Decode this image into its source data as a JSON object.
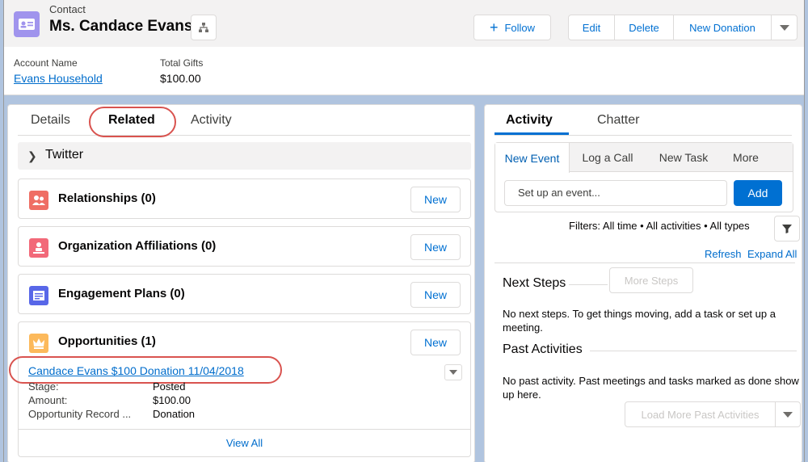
{
  "header": {
    "object_type": "Contact",
    "record_name": "Ms. Candace Evans",
    "buttons": {
      "follow": "Follow",
      "edit": "Edit",
      "delete": "Delete",
      "new_donation": "New Donation"
    },
    "fields": [
      {
        "label": "Account Name",
        "value": "Evans Household"
      },
      {
        "label": "Total Gifts",
        "value": "$100.00"
      }
    ]
  },
  "left_tabs": [
    "Details",
    "Related",
    "Activity"
  ],
  "twitter": {
    "label": "Twitter"
  },
  "related_lists": [
    {
      "title": "Relationships (0)",
      "new_label": "New",
      "icon": "relationships-icon",
      "color": "#ef6e64"
    },
    {
      "title": "Organization Affiliations (0)",
      "new_label": "New",
      "icon": "affiliations-icon",
      "color": "#f26979"
    },
    {
      "title": "Engagement Plans (0)",
      "new_label": "New",
      "icon": "engagement-plans-icon",
      "color": "#5867e8"
    },
    {
      "title": "Opportunities (1)",
      "new_label": "New",
      "icon": "opportunity-crown-icon",
      "color": "#fcb95b"
    }
  ],
  "opportunity": {
    "name": "Candace Evans $100 Donation 11/04/2018",
    "fields": [
      {
        "label": "Stage:",
        "value": "Posted"
      },
      {
        "label": "Amount:",
        "value": "$100.00"
      },
      {
        "label": "Opportunity Record ...",
        "value": "Donation"
      }
    ],
    "view_all": "View All"
  },
  "right_tabs": [
    "Activity",
    "Chatter"
  ],
  "composer": {
    "tabs": [
      "New Event",
      "Log a Call",
      "New Task",
      "More"
    ],
    "placeholder": "Set up an event...",
    "add_label": "Add"
  },
  "filters_text": "Filters: All time • All activities • All types",
  "refresh_label": "Refresh",
  "expand_all_label": "Expand All",
  "next_steps": {
    "title": "Next Steps",
    "more_steps_label": "More Steps",
    "empty_text": "No next steps. To get things moving, add a task or set up a meeting."
  },
  "past_activities": {
    "title": "Past Activities",
    "empty_text": "No past activity. Past meetings and tasks marked as done show up here.",
    "load_more_label": "Load More Past Activities"
  },
  "colors": {
    "accent": "#0070d2",
    "link": "#006dcc",
    "highlight": "#d9534f",
    "contact_icon": "#a094ed"
  }
}
